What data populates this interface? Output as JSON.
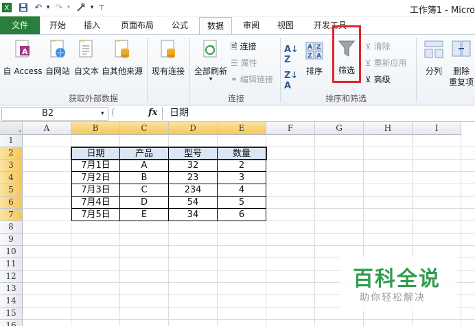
{
  "title_bar": {
    "window_title": "工作簿1 - Micro"
  },
  "tabs": [
    "文件",
    "开始",
    "插入",
    "页面布局",
    "公式",
    "数据",
    "审阅",
    "视图",
    "开发工具"
  ],
  "active_tab": "数据",
  "ribbon": {
    "external_data": {
      "buttons": [
        "自 Access",
        "自网站",
        "自文本",
        "自其他来源",
        "现有连接"
      ],
      "group_label": "获取外部数据"
    },
    "connections": {
      "refresh_label": "全部刷新",
      "items": [
        "连接",
        "属性",
        "编辑链接"
      ],
      "group_label": "连接"
    },
    "sort_filter": {
      "sort_label": "排序",
      "filter_label": "筛选",
      "small": [
        "清除",
        "重新应用",
        "高级"
      ],
      "group_label": "排序和筛选"
    },
    "data_tools": {
      "split_label": "分列",
      "remove_label_1": "删除",
      "remove_label_2": "重复项"
    },
    "highlight_color": "#e0242a"
  },
  "formula_bar": {
    "name_box": "B2",
    "fx": "fx",
    "value": "日期"
  },
  "sheet": {
    "columns": [
      "A",
      "B",
      "C",
      "D",
      "E",
      "F",
      "G",
      "H",
      "I"
    ],
    "rows": [
      "1",
      "2",
      "3",
      "4",
      "5",
      "6",
      "7",
      "8",
      "9",
      "10",
      "11",
      "12",
      "13",
      "14",
      "15",
      "16"
    ],
    "table_header": [
      "日期",
      "产品",
      "型号",
      "数量"
    ],
    "table_rows": [
      [
        "7月1日",
        "A",
        "32",
        "2"
      ],
      [
        "7月2日",
        "B",
        "23",
        "3"
      ],
      [
        "7月3日",
        "C",
        "234",
        "4"
      ],
      [
        "7月4日",
        "D",
        "54",
        "5"
      ],
      [
        "7月5日",
        "E",
        "34",
        "6"
      ]
    ]
  },
  "watermark": {
    "title": "百科全说",
    "subtitle": "助你轻松解决"
  }
}
